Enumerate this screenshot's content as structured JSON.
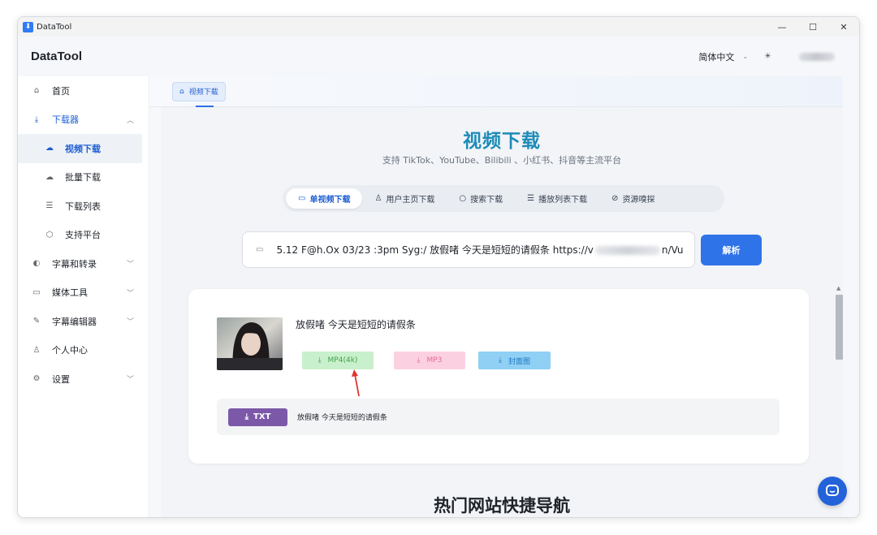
{
  "window": {
    "title": "DataTool",
    "controls": {
      "minimize": "—",
      "maximize": "☐",
      "close": "✕"
    }
  },
  "header": {
    "brand": "DataTool",
    "language": "简体中文",
    "theme_icon": "sun-icon"
  },
  "sidebar": {
    "items": [
      {
        "label": "首页",
        "icon": "home-icon"
      },
      {
        "label": "下载器",
        "icon": "download-icon",
        "expanded": true
      },
      {
        "label": "视频下载",
        "icon": "cloud-icon",
        "active": true
      },
      {
        "label": "批量下载",
        "icon": "cloud-icon"
      },
      {
        "label": "下载列表",
        "icon": "list-icon"
      },
      {
        "label": "支持平台",
        "icon": "cube-icon"
      },
      {
        "label": "字幕和转录",
        "icon": "mic-icon"
      },
      {
        "label": "媒体工具",
        "icon": "video-icon"
      },
      {
        "label": "字幕编辑器",
        "icon": "edit-icon"
      },
      {
        "label": "个人中心",
        "icon": "user-icon"
      },
      {
        "label": "设置",
        "icon": "settings-icon"
      }
    ]
  },
  "tabs": {
    "active": "视频下载"
  },
  "page": {
    "title": "视频下载",
    "subtitle": "支持 TikTok、YouTube、Bilibili 、小红书、抖音等主流平台",
    "modes": [
      {
        "label": "单视频下载",
        "active": true
      },
      {
        "label": "用户主页下载"
      },
      {
        "label": "搜索下载"
      },
      {
        "label": "播放列表下载"
      },
      {
        "label": "资源嗅探"
      }
    ],
    "url_input": {
      "prefix": "5.12 F@h.Ox 03/23 :3pm Syg:/ 放假啫 今天是短短的请假条  https://v",
      "suffix": "n/Vu"
    },
    "parse_button": "解析"
  },
  "result": {
    "title": "放假啫 今天是短短的请假条",
    "buttons": {
      "mp4": "MP4(4k)",
      "mp3": "MP3",
      "cover": "封面图"
    },
    "txt_button": "TXT",
    "txt_label": "放假啫 今天是短短的请假条"
  },
  "next_section_title": "热门网站快捷导航",
  "colors": {
    "accent": "#2f73e8",
    "title": "#1d8bb8",
    "mp4": "#c8f0cc",
    "mp3": "#fbd1e2",
    "cover": "#8fd0f4",
    "txt": "#7c59a8"
  }
}
